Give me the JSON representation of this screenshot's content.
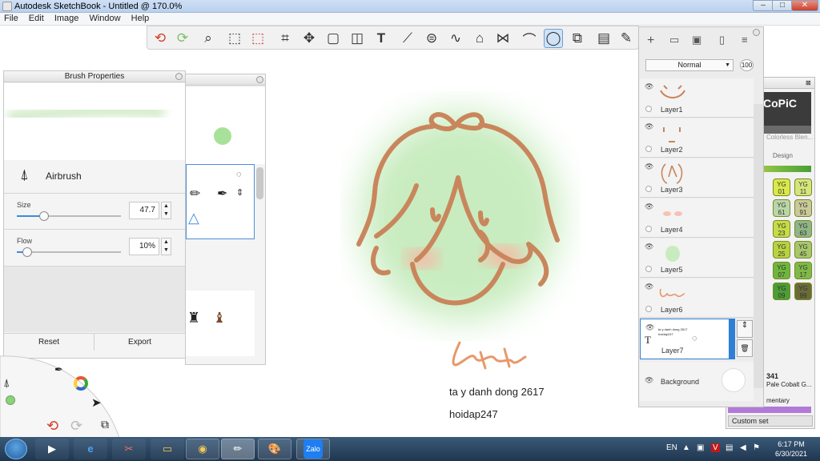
{
  "window": {
    "title": "Autodesk SketchBook - Untitled @ 170.0%",
    "min": "–",
    "max": "□",
    "close": "✕"
  },
  "menu": [
    "File",
    "Edit",
    "Image",
    "Window",
    "Help"
  ],
  "toolbar": {
    "icons": [
      "undo-icon",
      "redo-icon",
      "zoom-icon",
      "lasso-select-icon",
      "rect-select-icon",
      "crop-icon",
      "transform-icon",
      "distort-icon",
      "fill-icon",
      "text-icon",
      "ruler-icon",
      "ellipse-guide-icon",
      "french-curve-icon",
      "perspective-icon",
      "symmetry-icon",
      "stroke-icon",
      "circle-shape-icon",
      "copy-layer-icon",
      "layer-stack-icon",
      "brush-icon"
    ],
    "active_index": 16
  },
  "brush_properties": {
    "title": "Brush Properties",
    "brush_name": "Airbrush",
    "size_label": "Size",
    "size_value": "47.7",
    "size_fraction": 0.26,
    "flow_label": "Flow",
    "flow_value": "10%",
    "flow_fraction": 0.1,
    "reset": "Reset",
    "export": "Export"
  },
  "layers": {
    "blend_mode": "Normal",
    "opacity": "100",
    "items": [
      {
        "name": "Layer1"
      },
      {
        "name": "Layer2"
      },
      {
        "name": "Layer3"
      },
      {
        "name": "Layer4"
      },
      {
        "name": "Layer5"
      },
      {
        "name": "Layer6"
      },
      {
        "name": "Layer7",
        "selected": true,
        "thumb_text": "ta y danh dong 2617 hoidap247"
      },
      {
        "name": "Background"
      }
    ]
  },
  "copic": {
    "header_text": "CoPiC",
    "library_text": "Colorless Blen...",
    "tab_design": "Design",
    "swatches": [
      {
        "code": "YG 01",
        "color": "#d9e84a"
      },
      {
        "code": "YG 11",
        "color": "#d4e67a"
      },
      {
        "code": "YG 61",
        "color": "#b9d6a8"
      },
      {
        "code": "YG 91",
        "color": "#c9c99a"
      },
      {
        "code": "YG 23",
        "color": "#c6dc45"
      },
      {
        "code": "YG 63",
        "color": "#8fb588"
      },
      {
        "code": "YG 25",
        "color": "#b9d240"
      },
      {
        "code": "YG 45",
        "color": "#a7c76a"
      },
      {
        "code": "YG 07",
        "color": "#6fb63e"
      },
      {
        "code": "YG 17",
        "color": "#7fba48"
      },
      {
        "code": "YG 09",
        "color": "#4c9e35"
      },
      {
        "code": "YG 99",
        "color": "#6b6b3a"
      }
    ],
    "bottom_code": "341",
    "bottom_name": "Pale Cobalt G...",
    "bottom_sub": "mentary",
    "custom_set": "Custom set"
  },
  "canvas": {
    "line1": "ta y danh dong 2617",
    "line2": "hoidap247",
    "stroke_color": "#c9865c",
    "blush_color": "#f3b1a1",
    "glow_color": "#bfe6b4"
  },
  "taskbar": {
    "apps": [
      "media-player",
      "internet-explorer",
      "snipping-tool",
      "file-explorer",
      "chrome",
      "sketchbook",
      "paint",
      "zalo"
    ],
    "zalo_label": "Zalo",
    "lang": "EN",
    "time": "6:17 PM",
    "date": "6/30/2021"
  }
}
